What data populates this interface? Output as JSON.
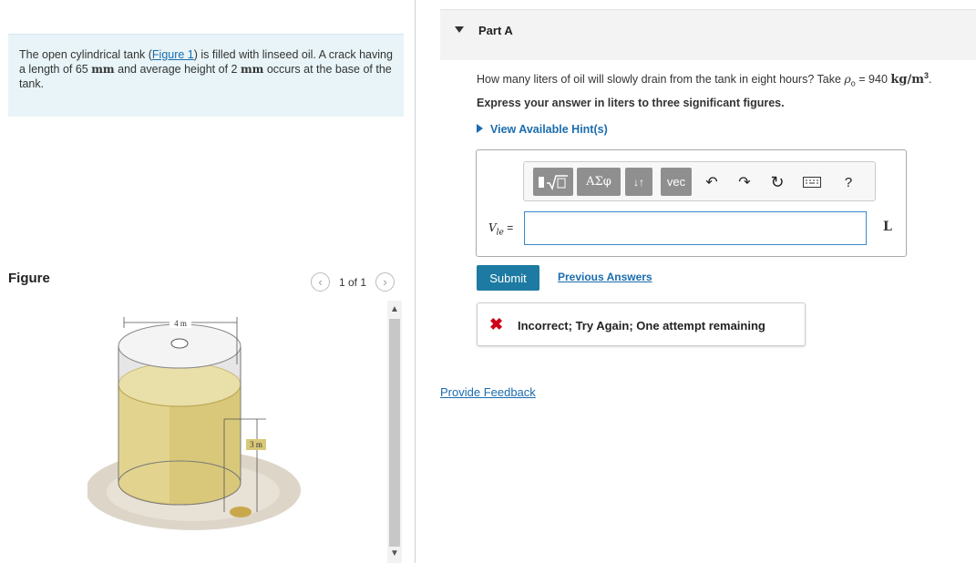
{
  "problem": {
    "text_before_link": "The open cylindrical tank (",
    "figure_link": "Figure 1",
    "text_after_link": ") is filled with linseed oil. A crack having a length of 65 ",
    "unit_mm_1": "mm",
    "text_mid": " and average height of 2 ",
    "unit_mm_2": "mm",
    "text_end": " occurs at the base of the tank."
  },
  "figure": {
    "label": "Figure",
    "count": "1 of 1",
    "prev_icon": "chevron-left-icon",
    "next_icon": "chevron-right-icon",
    "width_label": "4 m",
    "height_label": "3 m"
  },
  "part": {
    "title": "Part A"
  },
  "question": {
    "text": "How many liters of oil will slowly drain from the tank in eight hours? Take ",
    "rho_symbol": "ρ",
    "rho_sub": "o",
    "eq": " = 940 ",
    "unit": "kg/m",
    "unit_exp": "3",
    "end": "."
  },
  "instruction": "Express your answer in liters to three significant figures.",
  "hints_label": "View Available Hint(s)",
  "toolbar": {
    "templates_icon": "template-sqrt-icon",
    "greek_label": "ΑΣφ",
    "sort_label": "↓↑",
    "vec_label": "vec",
    "undo_icon": "undo-icon",
    "redo_icon": "redo-icon",
    "reset_icon": "reset-icon",
    "keyboard_icon": "keyboard-icon",
    "help_label": "?"
  },
  "answer": {
    "variable_label": "V",
    "variable_sub": "le",
    "equals": " =",
    "value": "",
    "unit": "L"
  },
  "buttons": {
    "submit": "Submit",
    "previous_answers": "Previous Answers"
  },
  "feedback": {
    "icon": "x-icon",
    "message": "Incorrect; Try Again; One attempt remaining"
  },
  "provide_feedback": "Provide Feedback",
  "colors": {
    "link": "#1a6cae",
    "submit_bg": "#1d7aa2",
    "error": "#d0021b",
    "problem_bg": "#e8f4f7"
  }
}
